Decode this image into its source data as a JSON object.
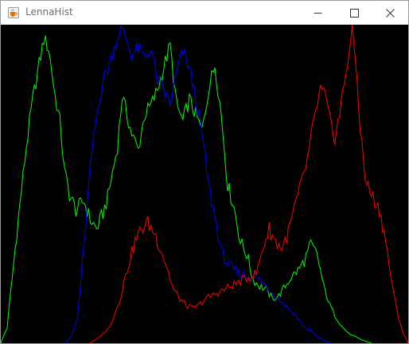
{
  "window": {
    "title": "LennaHist",
    "icon": "java-coffee-cup-icon",
    "controls": {
      "minimize_icon": "minimize-icon",
      "maximize_icon": "maximize-icon",
      "close_icon": "close-icon"
    }
  },
  "chart_data": {
    "type": "line",
    "title": "",
    "xlabel": "",
    "ylabel": "",
    "grid": false,
    "legend": "none",
    "background": "#000000",
    "x_range": [
      0,
      255
    ],
    "y_range": [
      0,
      1
    ],
    "series": [
      {
        "color": "#00ff00",
        "points": [
          [
            0,
            0.0
          ],
          [
            4,
            0.05
          ],
          [
            10,
            0.35
          ],
          [
            16,
            0.62
          ],
          [
            20,
            0.77
          ],
          [
            24,
            0.88
          ],
          [
            27,
            0.96
          ],
          [
            30,
            0.93
          ],
          [
            34,
            0.78
          ],
          [
            37,
            0.7
          ],
          [
            40,
            0.54
          ],
          [
            43,
            0.47
          ],
          [
            47,
            0.42
          ],
          [
            52,
            0.45
          ],
          [
            56,
            0.39
          ],
          [
            60,
            0.36
          ],
          [
            64,
            0.41
          ],
          [
            67,
            0.46
          ],
          [
            70,
            0.54
          ],
          [
            73,
            0.62
          ],
          [
            76,
            0.78
          ],
          [
            79,
            0.72
          ],
          [
            82,
            0.66
          ],
          [
            86,
            0.61
          ],
          [
            90,
            0.72
          ],
          [
            94,
            0.75
          ],
          [
            98,
            0.8
          ],
          [
            102,
            0.87
          ],
          [
            106,
            0.94
          ],
          [
            110,
            0.75
          ],
          [
            114,
            0.7
          ],
          [
            118,
            0.77
          ],
          [
            122,
            0.72
          ],
          [
            126,
            0.67
          ],
          [
            130,
            0.8
          ],
          [
            134,
            0.88
          ],
          [
            138,
            0.72
          ],
          [
            142,
            0.5
          ],
          [
            146,
            0.43
          ],
          [
            150,
            0.32
          ],
          [
            154,
            0.28
          ],
          [
            158,
            0.2
          ],
          [
            162,
            0.18
          ],
          [
            166,
            0.17
          ],
          [
            170,
            0.14
          ],
          [
            174,
            0.15
          ],
          [
            178,
            0.18
          ],
          [
            182,
            0.21
          ],
          [
            186,
            0.23
          ],
          [
            190,
            0.26
          ],
          [
            194,
            0.31
          ],
          [
            198,
            0.28
          ],
          [
            202,
            0.18
          ],
          [
            206,
            0.12
          ],
          [
            210,
            0.08
          ],
          [
            214,
            0.05
          ],
          [
            218,
            0.03
          ],
          [
            222,
            0.02
          ],
          [
            226,
            0.01
          ],
          [
            232,
            0.0
          ]
        ]
      },
      {
        "color": "#0000ff",
        "points": [
          [
            40,
            0.0
          ],
          [
            44,
            0.02
          ],
          [
            48,
            0.08
          ],
          [
            52,
            0.3
          ],
          [
            56,
            0.55
          ],
          [
            60,
            0.72
          ],
          [
            64,
            0.83
          ],
          [
            68,
            0.88
          ],
          [
            72,
            0.95
          ],
          [
            75,
            0.99
          ],
          [
            78,
            0.97
          ],
          [
            82,
            0.91
          ],
          [
            86,
            0.93
          ],
          [
            90,
            0.9
          ],
          [
            94,
            0.93
          ],
          [
            98,
            0.83
          ],
          [
            102,
            0.8
          ],
          [
            106,
            0.75
          ],
          [
            110,
            0.85
          ],
          [
            114,
            0.92
          ],
          [
            118,
            0.87
          ],
          [
            122,
            0.77
          ],
          [
            126,
            0.66
          ],
          [
            130,
            0.5
          ],
          [
            134,
            0.4
          ],
          [
            138,
            0.29
          ],
          [
            142,
            0.25
          ],
          [
            146,
            0.23
          ],
          [
            150,
            0.22
          ],
          [
            154,
            0.21
          ],
          [
            158,
            0.21
          ],
          [
            162,
            0.2
          ],
          [
            166,
            0.18
          ],
          [
            170,
            0.16
          ],
          [
            174,
            0.14
          ],
          [
            178,
            0.12
          ],
          [
            182,
            0.1
          ],
          [
            186,
            0.08
          ],
          [
            190,
            0.05
          ],
          [
            194,
            0.04
          ],
          [
            198,
            0.02
          ],
          [
            202,
            0.01
          ],
          [
            206,
            0.0
          ]
        ]
      },
      {
        "color": "#ff0000",
        "points": [
          [
            56,
            0.0
          ],
          [
            62,
            0.02
          ],
          [
            68,
            0.05
          ],
          [
            74,
            0.13
          ],
          [
            80,
            0.25
          ],
          [
            84,
            0.32
          ],
          [
            88,
            0.36
          ],
          [
            92,
            0.38
          ],
          [
            96,
            0.35
          ],
          [
            100,
            0.3
          ],
          [
            104,
            0.24
          ],
          [
            108,
            0.17
          ],
          [
            112,
            0.14
          ],
          [
            116,
            0.12
          ],
          [
            120,
            0.11
          ],
          [
            124,
            0.12
          ],
          [
            128,
            0.14
          ],
          [
            132,
            0.15
          ],
          [
            136,
            0.16
          ],
          [
            140,
            0.17
          ],
          [
            144,
            0.18
          ],
          [
            148,
            0.19
          ],
          [
            152,
            0.2
          ],
          [
            156,
            0.21
          ],
          [
            160,
            0.22
          ],
          [
            164,
            0.3
          ],
          [
            168,
            0.36
          ],
          [
            172,
            0.32
          ],
          [
            176,
            0.3
          ],
          [
            180,
            0.35
          ],
          [
            184,
            0.43
          ],
          [
            188,
            0.5
          ],
          [
            192,
            0.58
          ],
          [
            196,
            0.7
          ],
          [
            200,
            0.8
          ],
          [
            203,
            0.78
          ],
          [
            206,
            0.7
          ],
          [
            209,
            0.65
          ],
          [
            212,
            0.72
          ],
          [
            215,
            0.82
          ],
          [
            218,
            0.92
          ],
          [
            220,
            0.98
          ],
          [
            222,
            0.9
          ],
          [
            225,
            0.68
          ],
          [
            228,
            0.52
          ],
          [
            231,
            0.48
          ],
          [
            234,
            0.45
          ],
          [
            237,
            0.42
          ],
          [
            240,
            0.35
          ],
          [
            243,
            0.25
          ],
          [
            246,
            0.15
          ],
          [
            249,
            0.08
          ],
          [
            252,
            0.03
          ],
          [
            255,
            0.0
          ]
        ]
      }
    ]
  }
}
